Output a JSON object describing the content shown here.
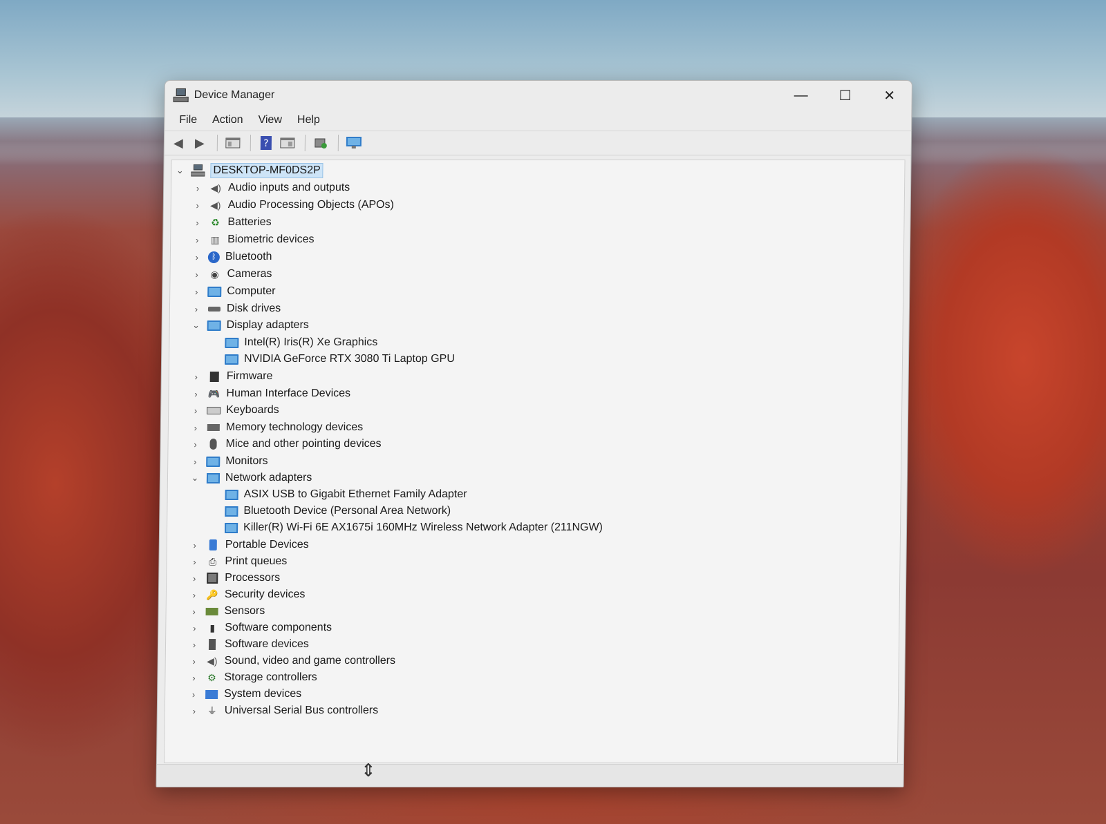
{
  "window": {
    "title": "Device Manager",
    "controls": {
      "minimize": "—",
      "maximize": "☐",
      "close": "✕"
    }
  },
  "menu": [
    "File",
    "Action",
    "View",
    "Help"
  ],
  "toolbar": {
    "icons": [
      "back-icon",
      "forward-icon",
      "show-hide-console-tree-icon",
      "help-icon",
      "properties-icon",
      "update-driver-icon",
      "scan-hardware-icon"
    ]
  },
  "tree": {
    "root": "DESKTOP-MF0DS2P",
    "items": [
      {
        "label": "Audio inputs and outputs",
        "expanded": false,
        "icon": "speaker-icon"
      },
      {
        "label": "Audio Processing Objects (APOs)",
        "expanded": false,
        "icon": "speaker-icon"
      },
      {
        "label": "Batteries",
        "expanded": false,
        "icon": "battery-icon"
      },
      {
        "label": "Biometric devices",
        "expanded": false,
        "icon": "fingerprint-icon"
      },
      {
        "label": "Bluetooth",
        "expanded": false,
        "icon": "bluetooth-icon"
      },
      {
        "label": "Cameras",
        "expanded": false,
        "icon": "camera-icon"
      },
      {
        "label": "Computer",
        "expanded": false,
        "icon": "monitor-icon"
      },
      {
        "label": "Disk drives",
        "expanded": false,
        "icon": "disk-icon"
      },
      {
        "label": "Display adapters",
        "expanded": true,
        "icon": "display-adapter-icon",
        "children": [
          "Intel(R) Iris(R) Xe Graphics",
          "NVIDIA GeForce RTX 3080 Ti Laptop GPU"
        ]
      },
      {
        "label": "Firmware",
        "expanded": false,
        "icon": "firmware-icon"
      },
      {
        "label": "Human Interface Devices",
        "expanded": false,
        "icon": "hid-icon"
      },
      {
        "label": "Keyboards",
        "expanded": false,
        "icon": "keyboard-icon"
      },
      {
        "label": "Memory technology devices",
        "expanded": false,
        "icon": "memory-icon"
      },
      {
        "label": "Mice and other pointing devices",
        "expanded": false,
        "icon": "mouse-icon"
      },
      {
        "label": "Monitors",
        "expanded": false,
        "icon": "monitor-icon"
      },
      {
        "label": "Network adapters",
        "expanded": true,
        "icon": "network-icon",
        "children": [
          "ASIX USB to Gigabit Ethernet Family Adapter",
          "Bluetooth Device (Personal Area Network)",
          "Killer(R) Wi-Fi 6E AX1675i 160MHz Wireless Network Adapter (211NGW)"
        ]
      },
      {
        "label": "Portable Devices",
        "expanded": false,
        "icon": "portable-device-icon"
      },
      {
        "label": "Print queues",
        "expanded": false,
        "icon": "printer-icon"
      },
      {
        "label": "Processors",
        "expanded": false,
        "icon": "processor-icon"
      },
      {
        "label": "Security devices",
        "expanded": false,
        "icon": "security-icon"
      },
      {
        "label": "Sensors",
        "expanded": false,
        "icon": "sensor-icon"
      },
      {
        "label": "Software components",
        "expanded": false,
        "icon": "software-component-icon"
      },
      {
        "label": "Software devices",
        "expanded": false,
        "icon": "software-device-icon"
      },
      {
        "label": "Sound, video and game controllers",
        "expanded": false,
        "icon": "speaker-icon"
      },
      {
        "label": "Storage controllers",
        "expanded": false,
        "icon": "storage-icon"
      },
      {
        "label": "System devices",
        "expanded": false,
        "icon": "system-icon"
      },
      {
        "label": "Universal Serial Bus controllers",
        "expanded": false,
        "icon": "usb-icon"
      }
    ]
  }
}
